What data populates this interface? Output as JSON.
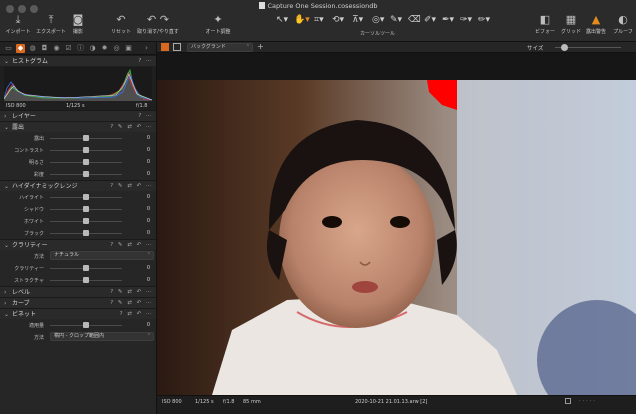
{
  "window": {
    "title": "Capture One Session.cosessiondb"
  },
  "toolbar": {
    "import": "インポート",
    "export": "エクスポート",
    "capture": "撮影",
    "reset": "リセット",
    "undo_redo": "取り消す/やり直す",
    "auto_adjust": "オート調整",
    "cursor_tools": "カーソルツール",
    "viewer": "ビフォー",
    "grid": "グリッド",
    "exposure_warning": "露出警告",
    "proof": "プルーフ"
  },
  "histogram": {
    "title": "ヒストグラム",
    "iso": "ISO 800",
    "shutter": "1/125 s",
    "aperture": "f/1.8"
  },
  "panels": {
    "layers": "レイヤー",
    "exposure": {
      "title": "露出",
      "sliders": [
        {
          "label": "露出",
          "value": "0",
          "position": 0.5
        },
        {
          "label": "コントラスト",
          "value": "0",
          "position": 0.5
        },
        {
          "label": "明るさ",
          "value": "0",
          "position": 0.5
        },
        {
          "label": "彩度",
          "value": "0",
          "position": 0.5
        }
      ]
    },
    "hdr": {
      "title": "ハイダイナミックレンジ",
      "sliders": [
        {
          "label": "ハイライト",
          "value": "0",
          "position": 0.5
        },
        {
          "label": "シャドウ",
          "value": "0",
          "position": 0.5
        },
        {
          "label": "ホワイト",
          "value": "0",
          "position": 0.5
        },
        {
          "label": "ブラック",
          "value": "0",
          "position": 0.5
        }
      ]
    },
    "clarity": {
      "title": "クラリティー",
      "method_label": "方法",
      "method_value": "ナチュラル",
      "sliders": [
        {
          "label": "クラリティー",
          "value": "0",
          "position": 0.5
        },
        {
          "label": "ストラクチャ",
          "value": "0",
          "position": 0.5
        }
      ]
    },
    "levels": "レベル",
    "curve": "カーブ",
    "vignette": {
      "title": "ビネット",
      "amount_label": "適用量",
      "amount_value": "0",
      "method_label": "方法",
      "method_value": "楕円 - クロップ範囲内"
    }
  },
  "viewer": {
    "background_label": "バックグランド",
    "size_label": "サイズ"
  },
  "status": {
    "iso": "ISO 800",
    "shutter": "1/125 s",
    "aperture": "f/1.8",
    "focal": "85 mm",
    "filename": "2020-10-21 21.01.13.arw [2]"
  },
  "colors": {
    "accent": "#d9691e",
    "warning": "#e58a1f",
    "clip_red": "#ff0000"
  }
}
